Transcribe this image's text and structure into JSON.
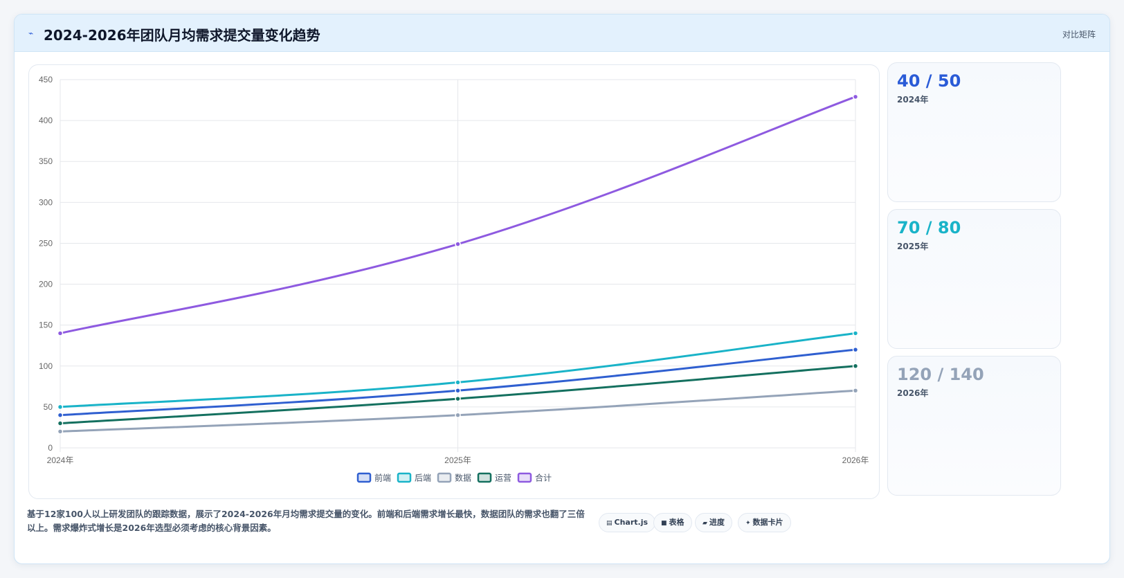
{
  "header": {
    "icon": "trend-line-icon",
    "title": "2024-2026年团队月均需求提交量变化趋势",
    "tag": "对比矩阵"
  },
  "chart_data": {
    "type": "line",
    "categories": [
      "2024年",
      "2025年",
      "2026年"
    ],
    "ylim": [
      0,
      450
    ],
    "yticks": [
      0,
      50,
      100,
      150,
      200,
      250,
      300,
      350,
      400,
      450
    ],
    "grid": true,
    "legend_position": "bottom",
    "series": [
      {
        "name": "前端",
        "color": "#2f5fd0",
        "values": [
          40,
          70,
          120
        ]
      },
      {
        "name": "后端",
        "color": "#19b3c8",
        "values": [
          50,
          80,
          140
        ]
      },
      {
        "name": "数据",
        "color": "#94a3b8",
        "values": [
          20,
          40,
          70
        ]
      },
      {
        "name": "运营",
        "color": "#14705f",
        "values": [
          30,
          60,
          100
        ]
      },
      {
        "name": "合计",
        "color": "#8e5ae0",
        "values": [
          140,
          249,
          429
        ]
      }
    ]
  },
  "side_cards": [
    {
      "value": "40 / 50",
      "label": "2024年",
      "color": "#2a5bd7"
    },
    {
      "value": "70 / 80",
      "label": "2025年",
      "color": "#19b3c8"
    },
    {
      "value": "120 / 140",
      "label": "2026年",
      "color": "#94a3b8"
    }
  ],
  "footer": {
    "text": "基于12家100人以上研发团队的跟踪数据，展示了2024-2026年月均需求提交量的变化。前端和后端需求增长最快，数据团队的需求也翻了三倍以上。需求爆炸式增长是2026年选型必须考虑的核心背景因素。",
    "buttons": [
      {
        "icon": "chart-icon",
        "glyph": "▤",
        "label": "Chart.js"
      },
      {
        "icon": "table-icon",
        "glyph": "■",
        "label": "表格"
      },
      {
        "icon": "progress-icon",
        "glyph": "▰",
        "label": "进度"
      },
      {
        "icon": "data-card-icon",
        "glyph": "✦",
        "label": "数据卡片"
      }
    ]
  }
}
